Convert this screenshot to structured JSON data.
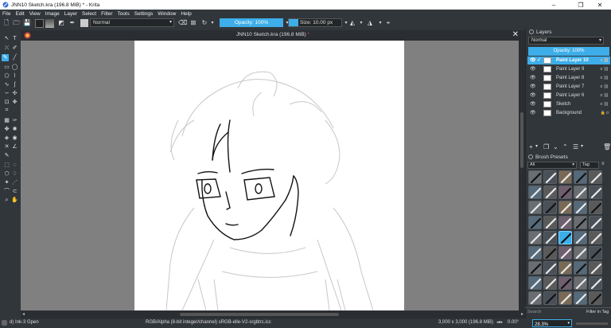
{
  "window": {
    "title": "JNN10 Sketch.kra (196.8 MiB) * - Krita",
    "minimize": "–",
    "maximize": "❐",
    "close": "✕"
  },
  "menu": [
    "File",
    "Edit",
    "View",
    "Image",
    "Layer",
    "Select",
    "Filter",
    "Tools",
    "Settings",
    "Window",
    "Help"
  ],
  "toolbar": {
    "blend_mode": "Normal",
    "opacity_label": "Opacity: 100%",
    "opacity": 1.0,
    "size_label": "Size: 10.00 px"
  },
  "document": {
    "tab_title": "JNN10 Sketch.kra (196.8 MiB)",
    "modified_mark": "*",
    "close": "✕"
  },
  "layers": {
    "title": "Layers",
    "blend_mode": "Normal",
    "opacity_label": "Opacity:  100%",
    "items": [
      {
        "name": "Paint Layer 10",
        "selected": true
      },
      {
        "name": "Paint Layer 9",
        "selected": false
      },
      {
        "name": "Paint Layer 8",
        "selected": false
      },
      {
        "name": "Paint Layer 7",
        "selected": false
      },
      {
        "name": "Paint Layer 6",
        "selected": false
      },
      {
        "name": "Sketch",
        "selected": false
      },
      {
        "name": "Background",
        "selected": false
      }
    ]
  },
  "brush_presets": {
    "title": "Brush Presets",
    "filter": "All",
    "tag_label": "Tag",
    "search_placeholder": "Search",
    "filter_in_tag": "Filter in Tag"
  },
  "status": {
    "brush": "d) Ink-3 Gpen",
    "color_model": "RGB/Alpha (8-bit integer/channel)  sRGB-elle-V2-srgbtrc.icc",
    "dimensions": "3,000 x 3,000 (196.8 MiB)",
    "rotation": "0.00°",
    "zoom": "28.3%"
  },
  "colors": {
    "accent": "#3daee9",
    "ui_bg": "#31363b",
    "canvas_bg": "#808080"
  }
}
